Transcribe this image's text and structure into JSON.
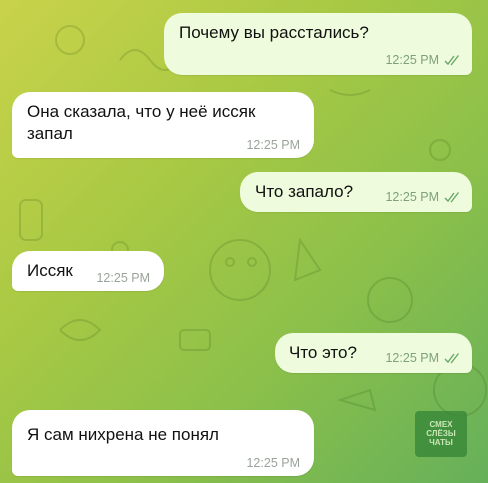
{
  "chat": {
    "messages": [
      {
        "direction": "outgoing",
        "text": "Почему вы расстались?",
        "time": "12:25 PM",
        "status": "read"
      },
      {
        "direction": "incoming",
        "text": "Она сказала, что у неё иссяк\nзапал",
        "time": "12:25 PM"
      },
      {
        "direction": "outgoing",
        "text": "Что запало?",
        "time": "12:25 PM",
        "status": "read"
      },
      {
        "direction": "incoming",
        "text": "Иссяк",
        "time": "12:25 PM"
      },
      {
        "direction": "outgoing",
        "text": "Что это?",
        "time": "12:25 PM",
        "status": "read"
      },
      {
        "direction": "incoming",
        "text": "Я сам нихрена не понял",
        "time": "12:25 PM"
      }
    ]
  },
  "watermark": {
    "lines": [
      "СМЕХ",
      "СЛЁЗЫ",
      "ЧАТЫ"
    ]
  },
  "colors": {
    "outgoing_bubble": "#eefbdc",
    "incoming_bubble": "#ffffff",
    "background_start": "#c9d24a",
    "background_end": "#66b05a",
    "check_color": "#6aa86a"
  }
}
